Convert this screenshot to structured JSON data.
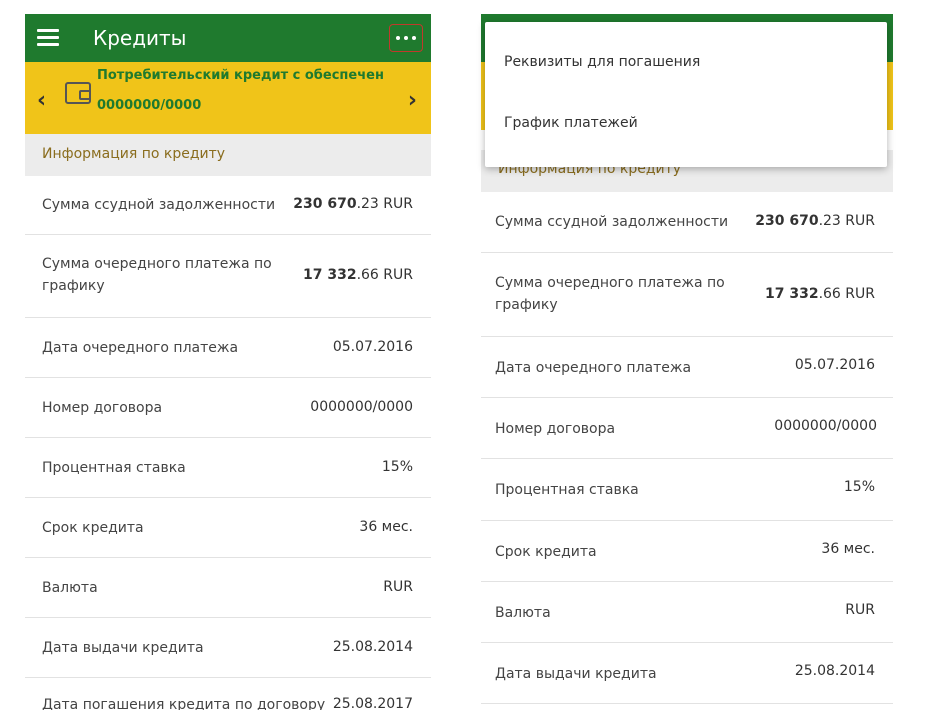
{
  "app": {
    "title": "Кредиты"
  },
  "loan": {
    "name": "Потребительский кредит с обеспечен",
    "number": "0000000/0000"
  },
  "section": {
    "title": "Информация по кредиту"
  },
  "rows": [
    {
      "label": "Сумма ссудной задолженности",
      "value_bold": "230 670",
      "value_rest": ".23 RUR"
    },
    {
      "label": "Сумма очередного платежа по графику",
      "value_bold": "17 332",
      "value_rest": ".66 RUR"
    },
    {
      "label": "Дата очередного платежа",
      "value": "05.07.2016"
    },
    {
      "label": "Номер договора",
      "value": "0000000/0000"
    },
    {
      "label": "Процентная ставка",
      "value": "15%"
    },
    {
      "label": "Срок кредита",
      "value": "36 мес."
    },
    {
      "label": "Валюта",
      "value": "RUR"
    },
    {
      "label": "Дата выдачи кредита",
      "value": "25.08.2014"
    },
    {
      "label": "Дата погашения кредита по договору",
      "value": "25.08.2017"
    }
  ],
  "menu": {
    "items": [
      "Реквизиты для погашения",
      "График платежей"
    ]
  },
  "colors": {
    "appbar": "#1f7a2e",
    "banner": "#f0c419",
    "section_text": "#8a6d1e",
    "highlight_border": "#c0392b"
  }
}
